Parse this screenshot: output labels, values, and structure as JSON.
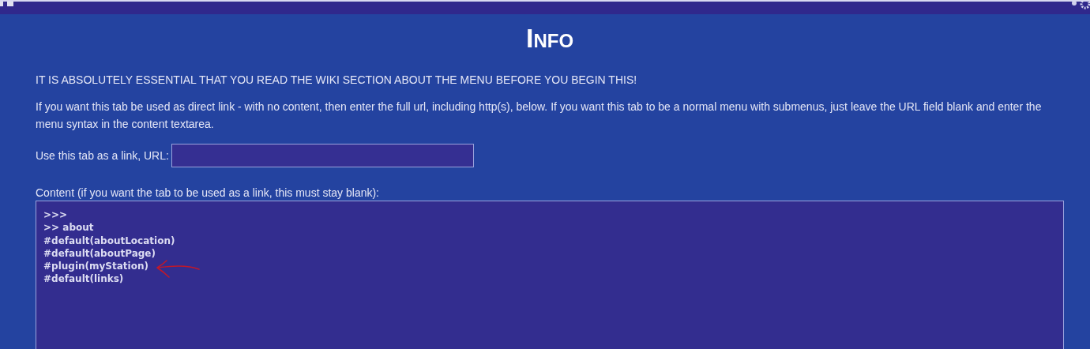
{
  "title": "Info",
  "warning": "IT IS ABSOLUTELY ESSENTIAL THAT YOU READ THE WIKI SECTION ABOUT THE MENU BEFORE YOU BEGIN THIS!",
  "description": "If you want this tab be used as direct link - with no content, then enter the full url, including http(s), below. If you want this tab to be a normal menu with submenus, just leave the URL field blank and enter the menu syntax in the content textarea.",
  "url_field": {
    "label": "Use this tab as a link, URL:"
  },
  "content_field": {
    "label": "Content (if you want the tab to be used as a link, this must stay blank):",
    "lines": [
      ">>>",
      ">> about",
      "#default(aboutLocation)",
      "#default(aboutPage)",
      "#plugin(myStation)",
      "#default(links)"
    ]
  }
}
